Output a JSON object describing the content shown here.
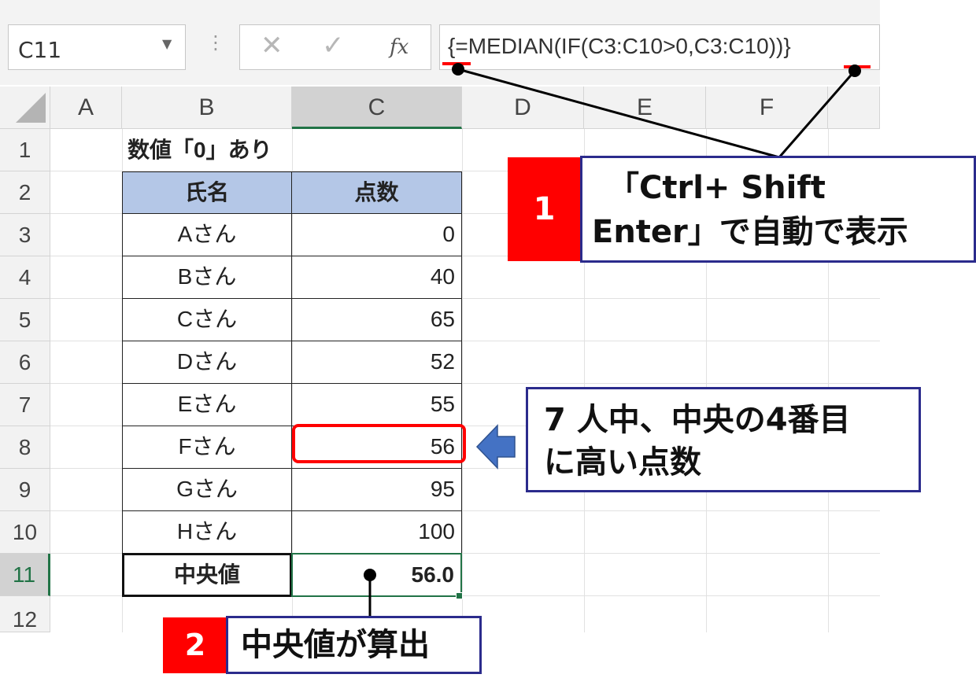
{
  "formula_bar": {
    "name_box": "C11",
    "cancel_symbol": "✕",
    "enter_symbol": "✓",
    "fx_label": "fx",
    "formula": "{=MEDIAN(IF(C3:C10>0,C3:C10))}"
  },
  "columns": [
    "A",
    "B",
    "C",
    "D",
    "E",
    "F"
  ],
  "rows": [
    "1",
    "2",
    "3",
    "4",
    "5",
    "6",
    "7",
    "8",
    "9",
    "10",
    "11",
    "12"
  ],
  "sheet": {
    "title": "数値「0」あり",
    "headers": {
      "name": "氏名",
      "score": "点数"
    },
    "records": [
      {
        "name": "Aさん",
        "score": "0"
      },
      {
        "name": "Bさん",
        "score": "40"
      },
      {
        "name": "Cさん",
        "score": "65"
      },
      {
        "name": "Dさん",
        "score": "52"
      },
      {
        "name": "Eさん",
        "score": "55"
      },
      {
        "name": "Fさん",
        "score": "56"
      },
      {
        "name": "Gさん",
        "score": "95"
      },
      {
        "name": "Hさん",
        "score": "100"
      }
    ],
    "median_label": "中央値",
    "median_value": "56.0"
  },
  "annotations": {
    "step1_number": "1",
    "step1_line1": "「Ctrl+ Shift",
    "step1_line2": "Enter」で自動で表示",
    "note_line1": "7 人中、中央の4番目",
    "note_line2": "に高い点数",
    "step2_number": "2",
    "step2_text": "中央値が算出"
  },
  "colors": {
    "header_fill": "#b4c7e7",
    "step_red": "#ff0000",
    "box_border": "#2b2b8c",
    "highlight": "#ff0000",
    "arrow": "#4472c4",
    "selection": "#217346"
  }
}
